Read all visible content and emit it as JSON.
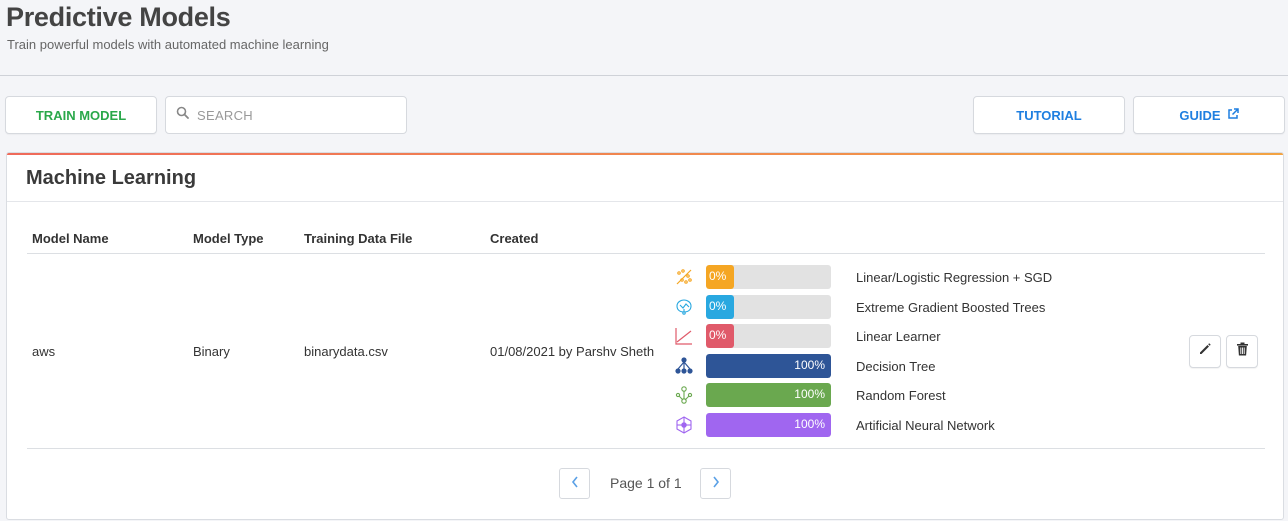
{
  "page": {
    "title": "Predictive Models",
    "subtitle": "Train powerful models with automated machine learning"
  },
  "toolbar": {
    "train_label": "TRAIN MODEL",
    "search_placeholder": "SEARCH",
    "tutorial_label": "TUTORIAL",
    "guide_label": "GUIDE"
  },
  "card": {
    "title": "Machine Learning"
  },
  "table": {
    "columns": [
      "Model Name",
      "Model Type",
      "Training Data File",
      "Created"
    ],
    "rows": [
      {
        "model_name": "aws",
        "model_type": "Binary",
        "training_file": "binarydata.csv",
        "created": "01/08/2021 by Parshv Sheth",
        "algorithms": [
          {
            "name": "Linear/Logistic Regression + SGD",
            "progress_label": "0%",
            "progress": 0,
            "color": "#f5a623",
            "icon": "regression-icon"
          },
          {
            "name": "Extreme Gradient Boosted Trees",
            "progress_label": "0%",
            "progress": 0,
            "color": "#29a8e0",
            "icon": "boosted-trees-icon"
          },
          {
            "name": "Linear Learner",
            "progress_label": "0%",
            "progress": 0,
            "color": "#e05a6a",
            "icon": "linear-learner-icon"
          },
          {
            "name": "Decision Tree",
            "progress_label": "100%",
            "progress": 100,
            "color": "#2e5597",
            "icon": "decision-tree-icon"
          },
          {
            "name": "Random Forest",
            "progress_label": "100%",
            "progress": 100,
            "color": "#6aa84f",
            "icon": "random-forest-icon"
          },
          {
            "name": "Artificial Neural Network",
            "progress_label": "100%",
            "progress": 100,
            "color": "#a066f0",
            "icon": "neural-network-icon"
          }
        ]
      }
    ]
  },
  "pagination": {
    "label": "Page 1 of 1"
  },
  "colors": {
    "accent_green": "#2aa84a",
    "accent_blue": "#1f7fe0"
  }
}
